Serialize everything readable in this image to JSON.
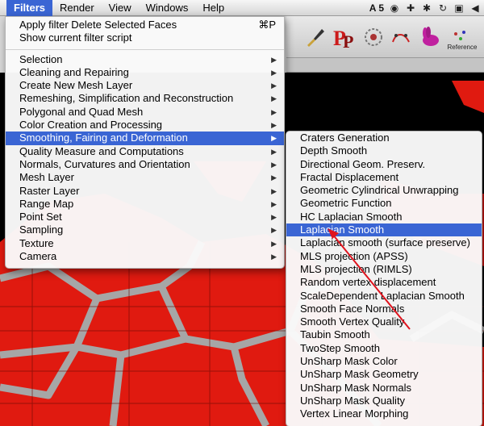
{
  "menubar": {
    "items": [
      "Filters",
      "Render",
      "View",
      "Windows",
      "Help"
    ],
    "active": "Filters",
    "status_text": "A 5"
  },
  "toolbar": {
    "reference_label": "Reference"
  },
  "filters_menu": {
    "top_items": [
      {
        "label": "Apply filter Delete Selected Faces",
        "shortcut": "⌘P"
      },
      {
        "label": "Show current filter script",
        "shortcut": ""
      }
    ],
    "submenus": [
      "Selection",
      "Cleaning and Repairing",
      "Create New Mesh Layer",
      "Remeshing, Simplification and Reconstruction",
      "Polygonal and Quad Mesh",
      "Color Creation and Processing",
      "Smoothing, Fairing and Deformation",
      "Quality Measure and Computations",
      "Normals, Curvatures and Orientation",
      "Mesh Layer",
      "Raster Layer",
      "Range Map",
      "Point Set",
      "Sampling",
      "Texture",
      "Camera"
    ],
    "highlighted": "Smoothing, Fairing and Deformation"
  },
  "smoothing_menu": {
    "items": [
      "Craters Generation",
      "Depth Smooth",
      "Directional Geom. Preserv.",
      "Fractal Displacement",
      "Geometric Cylindrical Unwrapping",
      "Geometric Function",
      "HC Laplacian Smooth",
      "Laplacian Smooth",
      "Laplacian smooth (surface preserve)",
      "MLS projection (APSS)",
      "MLS projection (RIMLS)",
      "Random vertex displacement",
      "ScaleDependent Laplacian Smooth",
      "Smooth Face Normals",
      "Smooth Vertex Quality",
      "Taubin Smooth",
      "TwoStep Smooth",
      "UnSharp Mask Color",
      "UnSharp Mask Geometry",
      "UnSharp Mask Normals",
      "UnSharp Mask Quality",
      "Vertex Linear Morphing"
    ],
    "highlighted": "Laplacian Smooth"
  },
  "colors": {
    "menu_highlight": "#3a65d4",
    "mesh_red": "#e01a10",
    "annotation_arrow": "#e0141e"
  },
  "icons": [
    "wifi-icon",
    "plus-icon",
    "bluetooth-icon",
    "lock-icon",
    "volume-icon",
    "paintbrush-icon",
    "pp-icon",
    "flask-icon",
    "bunny-icon",
    "reference-icon"
  ]
}
